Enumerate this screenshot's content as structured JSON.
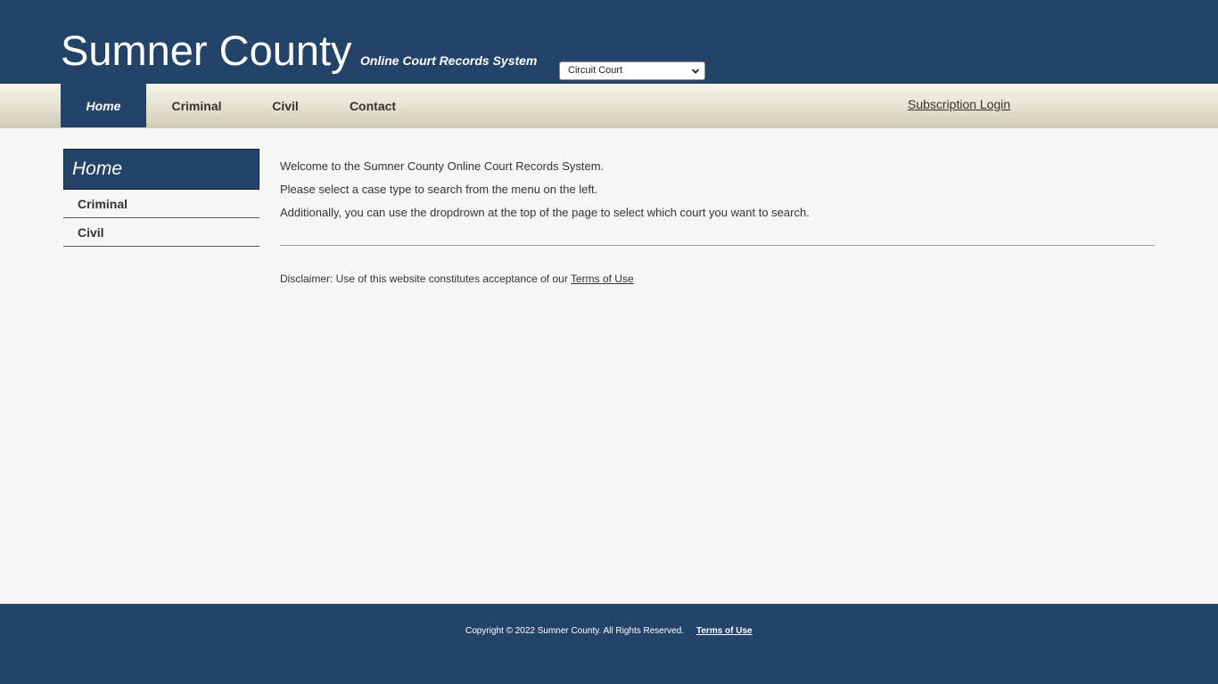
{
  "header": {
    "title": "Sumner County",
    "subtitle": "Online Court Records System",
    "court_select": {
      "selected": "Circuit Court",
      "icon": "chevron-down-icon"
    }
  },
  "nav": {
    "items": [
      {
        "label": "Home",
        "active": true
      },
      {
        "label": "Criminal",
        "active": false
      },
      {
        "label": "Civil",
        "active": false
      },
      {
        "label": "Contact",
        "active": false
      }
    ],
    "subscription_login": "Subscription Login"
  },
  "sidebar": {
    "title": "Home",
    "items": [
      {
        "label": "Criminal"
      },
      {
        "label": "Civil"
      }
    ]
  },
  "main": {
    "lines": [
      "Welcome to the Sumner County Online Court Records System.",
      "Please select a case type to search from the menu on the left.",
      "Additionally, you can use the dropdrown at the top of the page to select which court you want to search."
    ],
    "disclaimer_text": "Disclaimer: Use of this website constitutes acceptance of our",
    "disclaimer_link": "Terms of Use"
  },
  "footer": {
    "copyright": "Copyright © 2022 Sumner County. All Rights Reserved.",
    "terms_link": "Terms of Use"
  },
  "colors": {
    "brand": "#234468",
    "nav_gradient_top": "#f6f5ea",
    "nav_gradient_bottom": "#cfcab2",
    "background": "#f7f7f7"
  }
}
